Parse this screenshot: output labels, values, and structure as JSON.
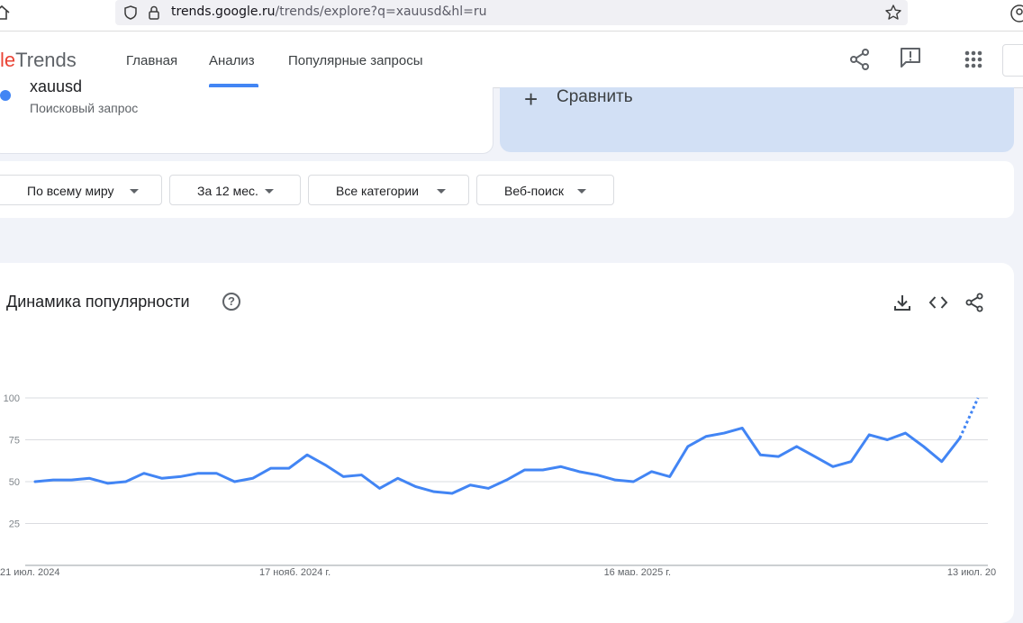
{
  "browser": {
    "url_host": "trends.google.ru",
    "url_path": "/trends/explore?q=xauusd&hl=ru"
  },
  "header": {
    "logo_colored": "le",
    "logo_text": "Trends",
    "nav": [
      "Главная",
      "Анализ",
      "Популярные запросы"
    ],
    "active_tab": "Анализ"
  },
  "term": {
    "name": "xauusd",
    "type": "Поисковый запрос",
    "color": "#4285f4"
  },
  "compare": {
    "label": "Сравнить"
  },
  "filters": {
    "region": "По всему миру",
    "period": "За 12 мес.",
    "category": "Все категории",
    "search_type": "Веб-поиск"
  },
  "chart_section": {
    "title": "Динамика популярности",
    "help_icon": "?"
  },
  "chart_data": {
    "type": "line",
    "ylim": [
      0,
      100
    ],
    "yticks": [
      25,
      50,
      75,
      100
    ],
    "x_tick_labels": [
      "21 июл. 2024",
      "17 нояб. 2024 г.",
      "16 мар. 2025 г.",
      "13 июл. 20"
    ],
    "grid": true,
    "series": [
      {
        "color": "#4285f4",
        "values": [
          50,
          51,
          51,
          52,
          49,
          50,
          55,
          52,
          53,
          55,
          55,
          50,
          52,
          58,
          58,
          66,
          60,
          53,
          54,
          46,
          52,
          47,
          44,
          43,
          48,
          46,
          51,
          57,
          57,
          59,
          56,
          54,
          51,
          50,
          56,
          53,
          71,
          77,
          79,
          82,
          66,
          65,
          71,
          65,
          59,
          62,
          78,
          75,
          79,
          71,
          62,
          76,
          100
        ],
        "partial_last_point": true
      }
    ]
  }
}
